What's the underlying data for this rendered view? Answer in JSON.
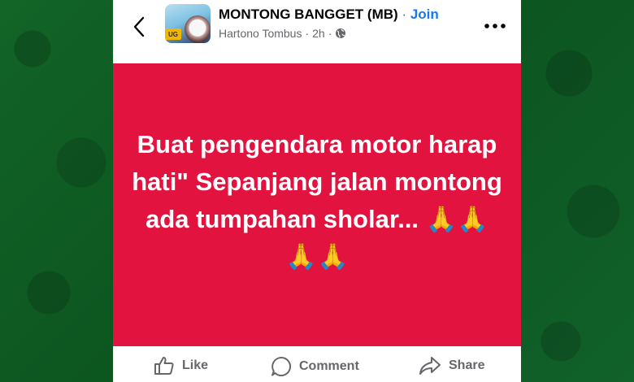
{
  "header": {
    "back_icon": "chevron-left-icon",
    "group_name": "MONTONG BANGGET (MB)",
    "separator": "·",
    "join_label": "Join",
    "author": "Hartono Tombus",
    "time": "2h",
    "meta_separator": "·",
    "privacy_icon": "globe-icon",
    "more_icon": "ellipsis-icon",
    "avatar_tag": "UG"
  },
  "post": {
    "text": "Buat pengendara motor harap hati\" Sepanjang jalan montong ada tumpahan sholar... 🙏🙏 🙏🙏",
    "background_color": "#e2133f",
    "text_color": "#ffffff"
  },
  "actions": {
    "like_label": "Like",
    "like_icon": "thumbs-up-icon",
    "comment_label": "Comment",
    "comment_icon": "speech-bubble-icon",
    "share_label": "Share",
    "share_icon": "share-arrow-icon"
  },
  "colors": {
    "link": "#1877f2",
    "secondary_text": "#65676b",
    "page_background": "#0f5a22"
  }
}
